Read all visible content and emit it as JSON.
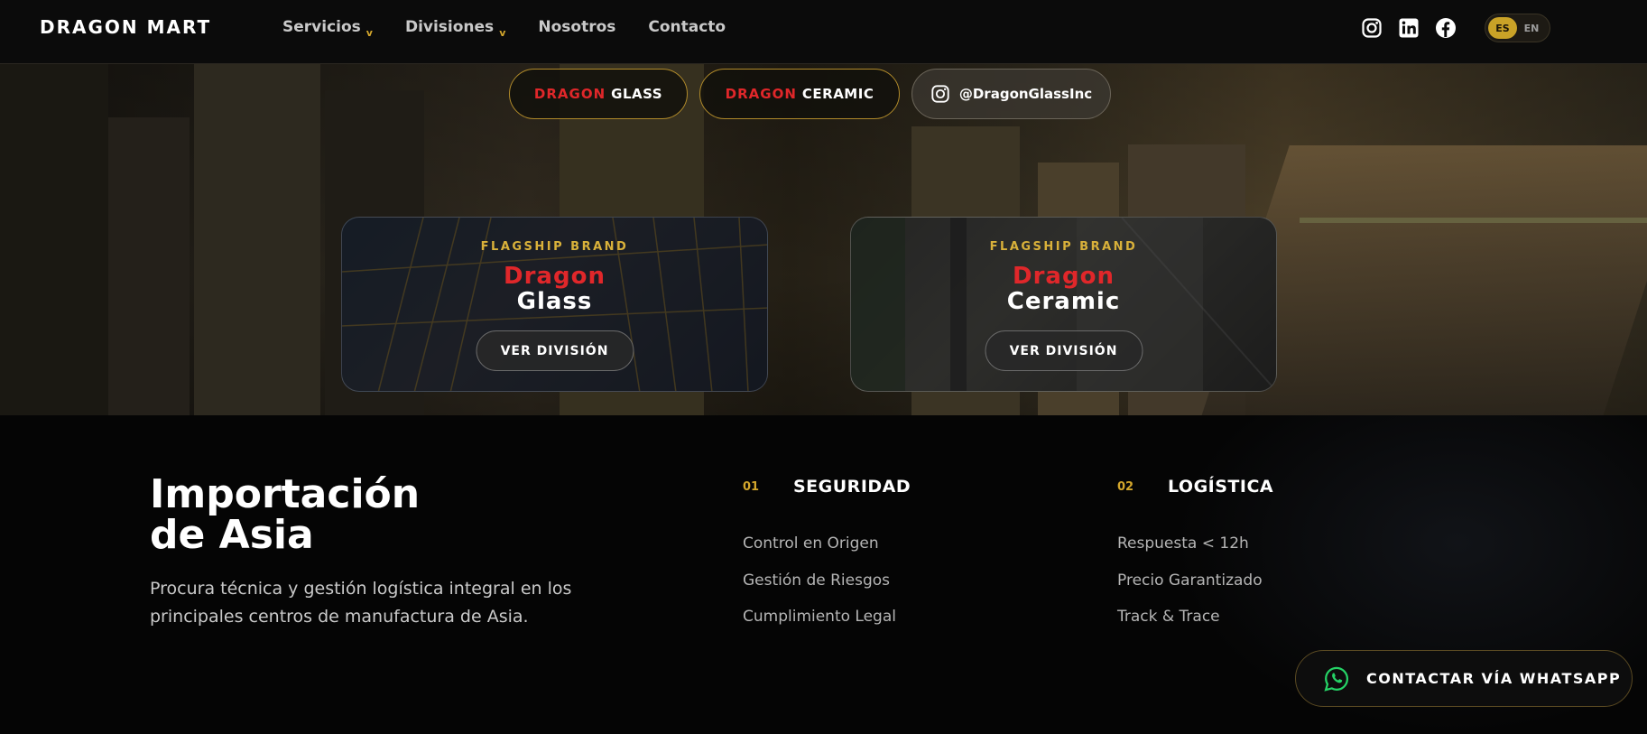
{
  "brand": {
    "logo": "DRAGON MART"
  },
  "nav": {
    "items": [
      {
        "label": "Servicios",
        "has_dropdown": true
      },
      {
        "label": "Divisiones",
        "has_dropdown": true
      },
      {
        "label": "Nosotros",
        "has_dropdown": false
      },
      {
        "label": "Contacto",
        "has_dropdown": false
      }
    ],
    "dropdown_glyph": "v"
  },
  "socials": [
    "instagram-icon",
    "linkedin-icon",
    "facebook-icon"
  ],
  "lang": {
    "active": "ES",
    "inactive": "EN"
  },
  "pills": {
    "glass": {
      "red": "DRAGON",
      "white": "GLASS"
    },
    "ceramic": {
      "red": "DRAGON",
      "white": "CERAMIC"
    },
    "instagram": {
      "handle": "@DragonGlassInc"
    }
  },
  "cards": [
    {
      "eyebrow": "FLAGSHIP BRAND",
      "title_red": "Dragon",
      "title_white": "Glass",
      "button": "VER DIVISIÓN"
    },
    {
      "eyebrow": "FLAGSHIP BRAND",
      "title_red": "Dragon",
      "title_white": "Ceramic",
      "button": "VER DIVISIÓN"
    }
  ],
  "import": {
    "title_line1": "Importación",
    "title_line2": "de Asia",
    "description": "Procura técnica y gestión logística integral en los principales centros de manufactura de Asia."
  },
  "columns": [
    {
      "number": "01",
      "heading": "SEGURIDAD",
      "items": [
        "Control en Origen",
        "Gestión de Riesgos",
        "Cumplimiento Legal"
      ]
    },
    {
      "number": "02",
      "heading": "LOGÍSTICA",
      "items": [
        "Respuesta < 12h",
        "Precio Garantizado",
        "Track & Trace"
      ]
    }
  ],
  "whatsapp": {
    "label": "CONTACTAR VÍA WHATSAPP"
  },
  "colors": {
    "accent_gold": "#d4a72c",
    "brand_red": "#e0272a",
    "bg_dark": "#050505"
  }
}
